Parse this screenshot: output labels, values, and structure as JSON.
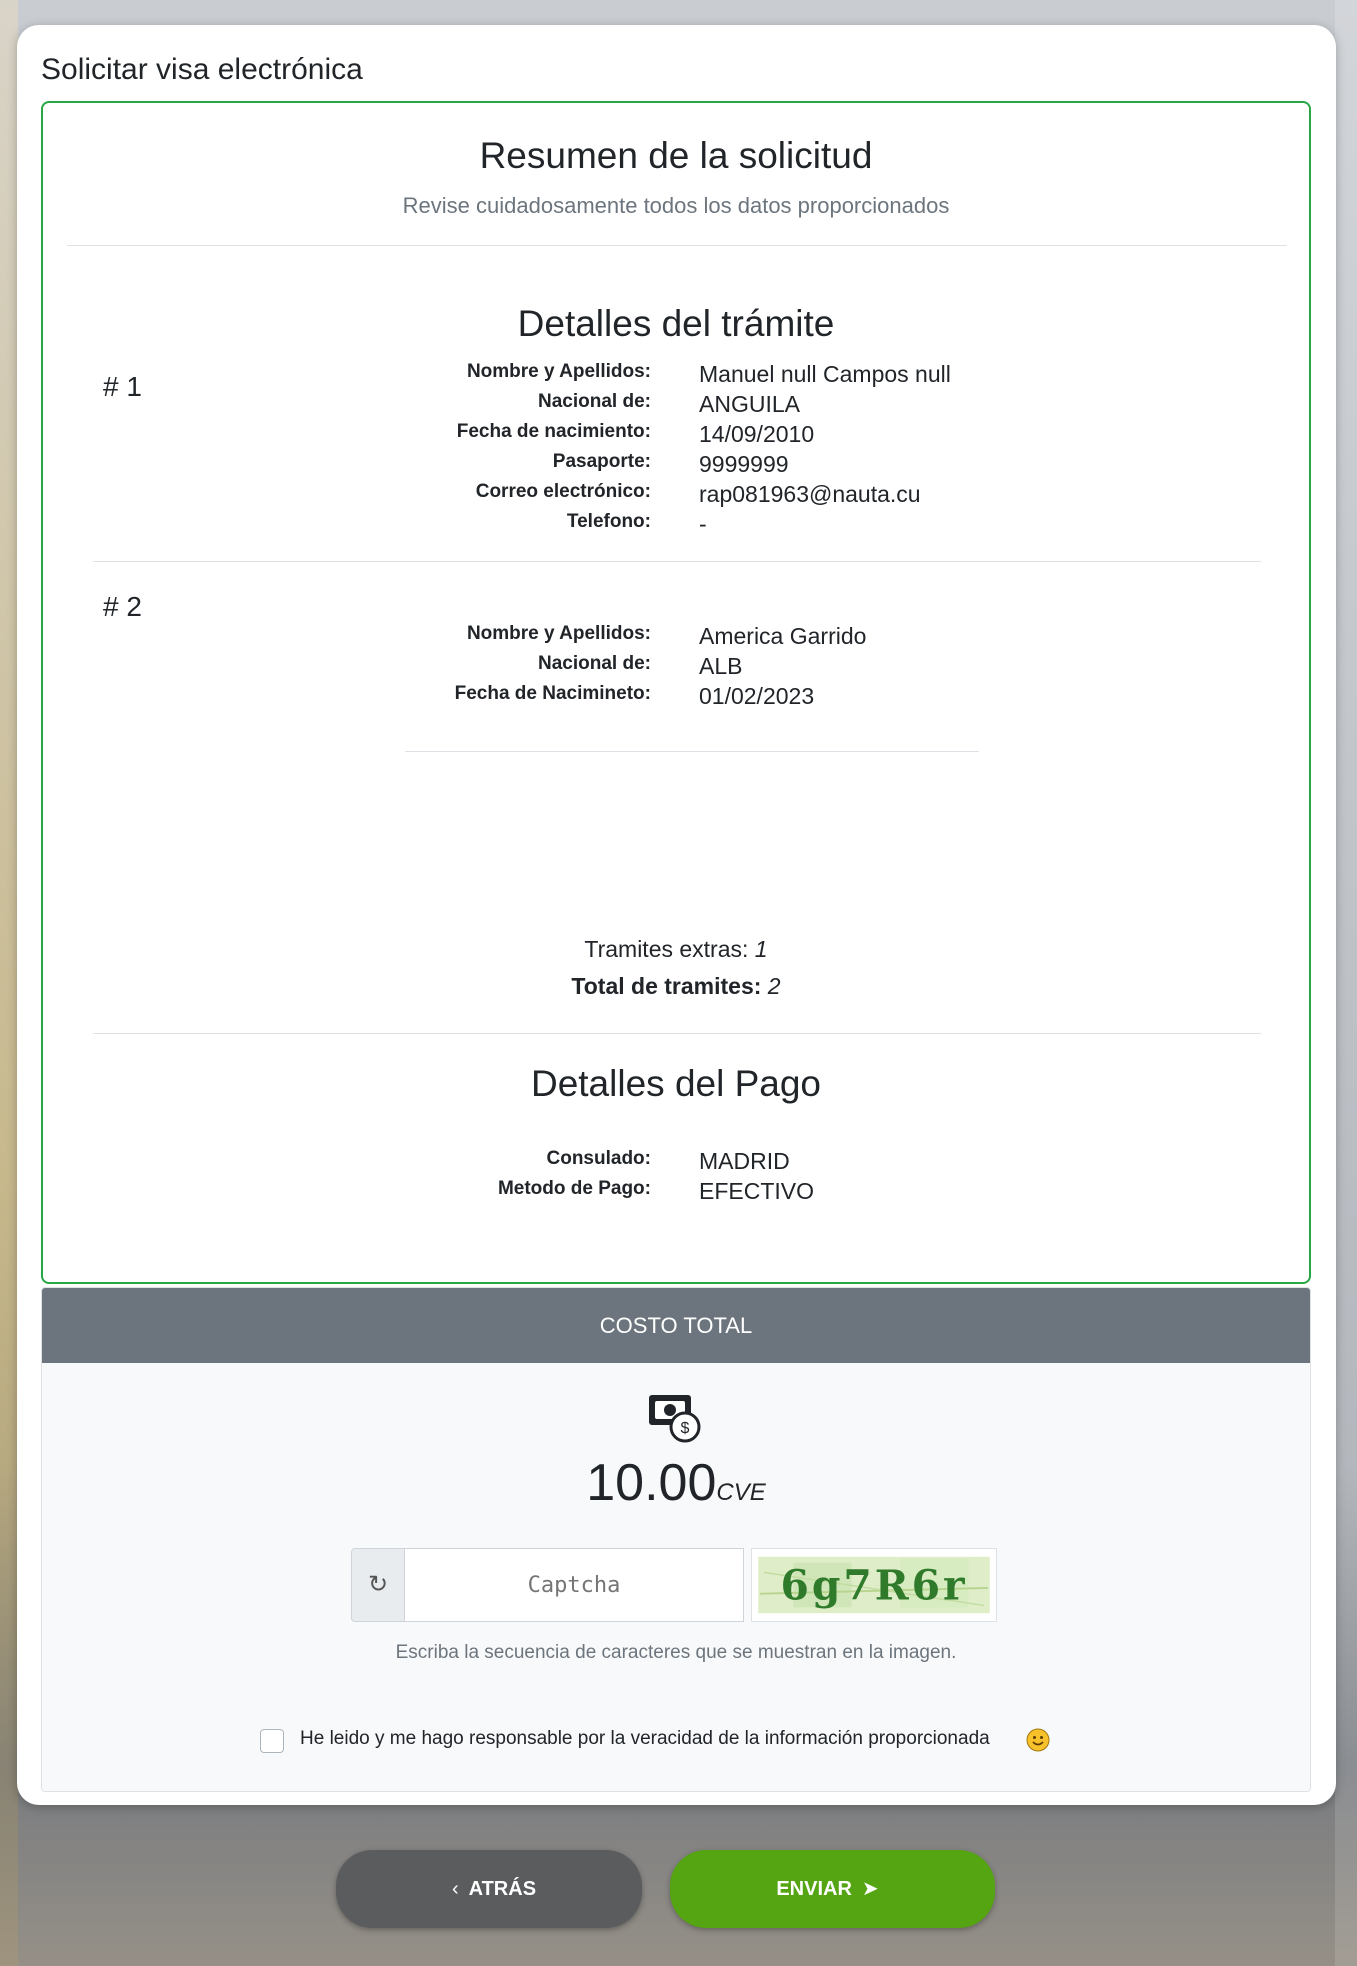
{
  "card": {
    "title": "Solicitar visa electrónica"
  },
  "summary": {
    "title": "Resumen de la solicitud",
    "subtitle": "Revise cuidadosamente todos los datos proporcionados",
    "details_title": "Detalles del trámite",
    "applicants": [
      {
        "number": "# 1",
        "fields": [
          {
            "label": "Nombre y Apellidos:",
            "value": "Manuel null Campos null"
          },
          {
            "label": "Nacional de:",
            "value": "ANGUILA"
          },
          {
            "label": "Fecha de nacimiento:",
            "value": "14/09/2010"
          },
          {
            "label": "Pasaporte:",
            "value": "9999999"
          },
          {
            "label": "Correo electrónico:",
            "value": "rap081963@nauta.cu"
          },
          {
            "label": "Telefono:",
            "value": "-"
          }
        ]
      },
      {
        "number": "# 2",
        "fields": [
          {
            "label": "Nombre y Apellidos:",
            "value": "America Garrido"
          },
          {
            "label": "Nacional de:",
            "value": "ALB"
          },
          {
            "label": "Fecha de Nacimineto:",
            "value": "01/02/2023"
          }
        ]
      }
    ],
    "extras_label": "Tramites extras: ",
    "extras_value": "1",
    "total_label": "Total de tramites:",
    "total_value": "2",
    "payment_title": "Detalles del Pago",
    "payment": [
      {
        "label": "Consulado:",
        "value": "MADRID"
      },
      {
        "label": "Metodo de Pago:",
        "value": "EFECTIVO"
      }
    ]
  },
  "cost": {
    "header": "COSTO TOTAL",
    "amount": "10.00",
    "currency": "CVE",
    "icon": "money-icon"
  },
  "captcha": {
    "placeholder": "Captcha",
    "image_text": "6g7R6r",
    "help": "Escriba la secuencia de caracteres que se muestran en la imagen.",
    "refresh_icon": "refresh-icon"
  },
  "consent": {
    "text": "He leido y me hago responsable por la veracidad de la información proporcionada",
    "checked": false,
    "emoji_icon": "smile-icon"
  },
  "buttons": {
    "back": "ATRÁS",
    "send": "ENVIAR"
  },
  "colors": {
    "success": "#28a745",
    "secondary": "#6c757d",
    "send_button": "#55a512",
    "back_button": "#5a5c5e"
  }
}
